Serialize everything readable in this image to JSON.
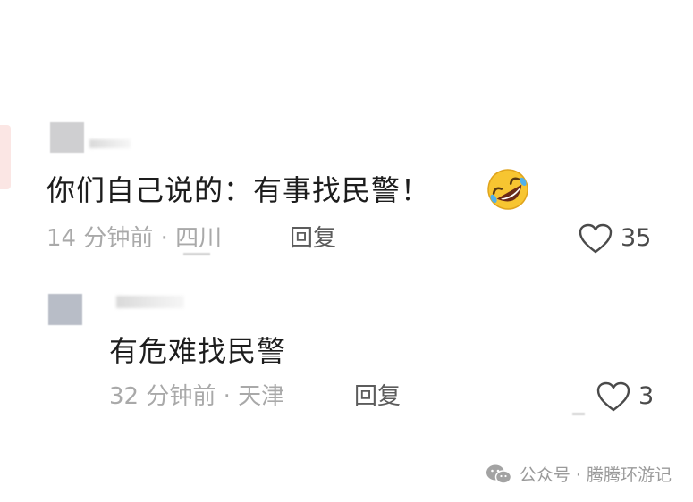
{
  "comments": [
    {
      "text": "你们自己说的：有事找民警！",
      "time_location": "14 分钟前 · 四川",
      "reply_label": "回复",
      "likes": "35",
      "emoji_icon": "rolling-on-floor-laughing-icon"
    },
    {
      "text": "有危难找民警",
      "time_location": "32 分钟前 · 天津",
      "reply_label": "回复",
      "likes": "3"
    }
  ],
  "watermark": {
    "text": "公众号 · 腾腾环游记",
    "icon": "wechat-icon"
  },
  "colors": {
    "meta_text": "#a9a9a9",
    "reply_text": "#5c5c5c",
    "avatar": "#cfcfd1",
    "watermark": "#9a9a9a"
  }
}
